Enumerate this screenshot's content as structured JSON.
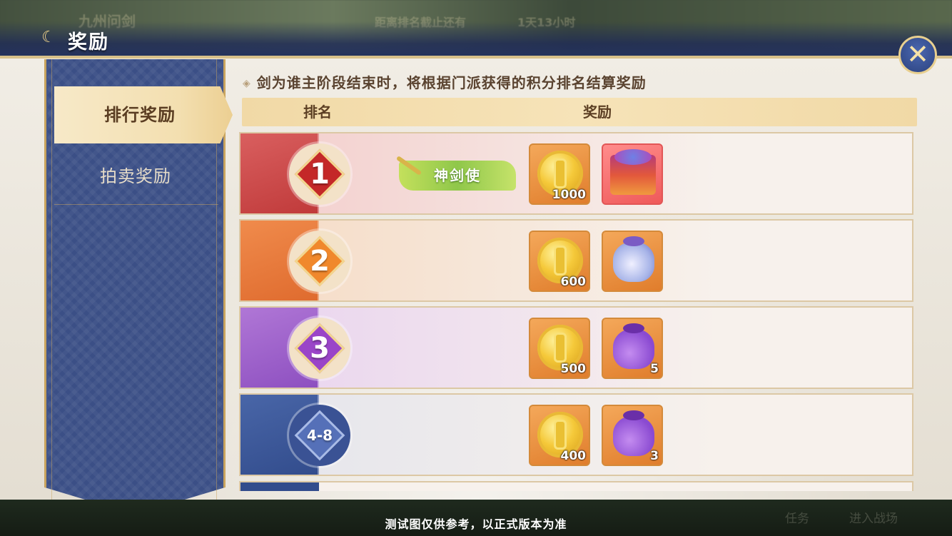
{
  "header": {
    "title": "奖励"
  },
  "background": {
    "ghost_top_left": "九州问剑",
    "ghost_top_center": "距离排名截止还有",
    "ghost_top_center2": "1天13小时",
    "ghost_bottom_a": "任务",
    "ghost_bottom_b": "进入战场"
  },
  "nav": {
    "tabs": [
      {
        "label": "排行奖励",
        "active": true
      },
      {
        "label": "拍卖奖励",
        "active": false
      }
    ]
  },
  "content": {
    "description": "剑为谁主阶段结束时，将根据门派获得的积分排名结算奖励",
    "table_headers": {
      "rank": "排名",
      "reward": "奖励"
    },
    "rows": [
      {
        "rank": "1",
        "title_badge": "神剑使",
        "items": [
          {
            "icon": "gold-coin-icon",
            "qty": "1000"
          },
          {
            "icon": "treasure-chest-icon",
            "qty": ""
          }
        ]
      },
      {
        "rank": "2",
        "items": [
          {
            "icon": "gold-coin-icon",
            "qty": "600"
          },
          {
            "icon": "lucky-bag-icon",
            "qty": ""
          }
        ]
      },
      {
        "rank": "3",
        "items": [
          {
            "icon": "gold-coin-icon",
            "qty": "500"
          },
          {
            "icon": "purple-pouch-icon",
            "qty": "5"
          }
        ]
      },
      {
        "rank": "4-8",
        "items": [
          {
            "icon": "gold-coin-icon",
            "qty": "400"
          },
          {
            "icon": "purple-pouch-icon",
            "qty": "3"
          }
        ]
      }
    ]
  },
  "close_icon": "close-icon",
  "footer": {
    "notice": "测试图仅供参考，以正式版本为准"
  },
  "colors": {
    "rank1": "#c42828",
    "rank2": "#f0882c",
    "rank3": "#9a45c8",
    "rank4": "#3a5294",
    "nav_bg": "#3b4f86",
    "accent_gold": "#e8cf8f"
  }
}
